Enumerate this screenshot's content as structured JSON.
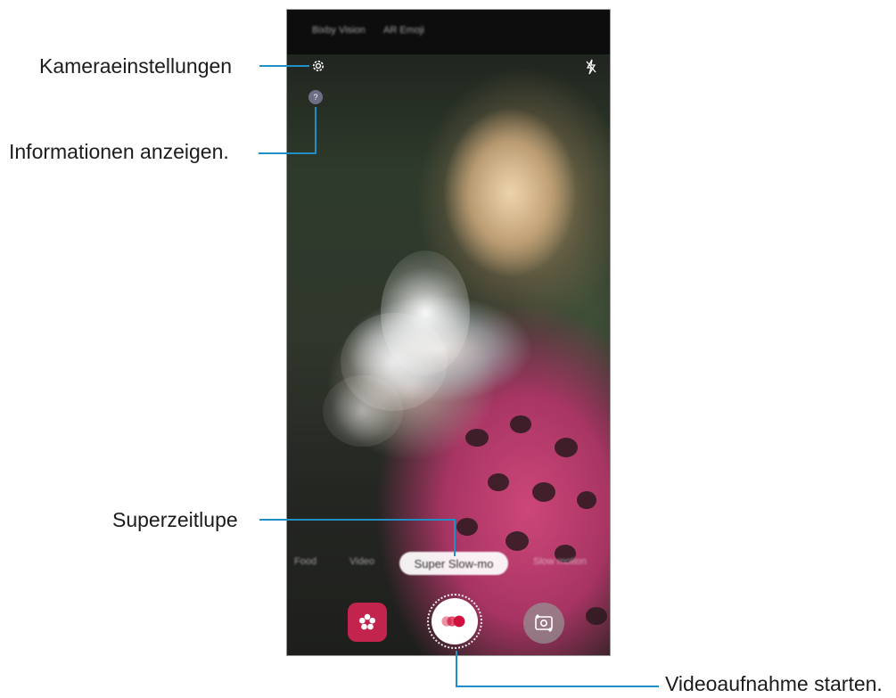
{
  "callouts": {
    "camera_settings": "Kameraeinstellungen",
    "show_info": "Informationen anzeigen.",
    "super_slow_mo": "Superzeitlupe",
    "start_recording": "Videoaufnahme starten."
  },
  "screen": {
    "top_tabs": [
      "Bixby Vision",
      "AR Emoji"
    ],
    "info_glyph": "?",
    "modes": {
      "left": [
        "Food",
        "Video"
      ],
      "selected": "Super Slow-mo",
      "right": "Slow motion"
    }
  },
  "icons": {
    "settings": "gear-icon",
    "flash": "flash-off-icon",
    "gallery": "gallery-icon",
    "record": "super-slow-mo-record-icon",
    "switch_camera": "switch-camera-icon"
  },
  "colors": {
    "callout_line": "#1f8fc6",
    "gallery_button": "#c3244d",
    "record_dots": "#d0103a"
  }
}
